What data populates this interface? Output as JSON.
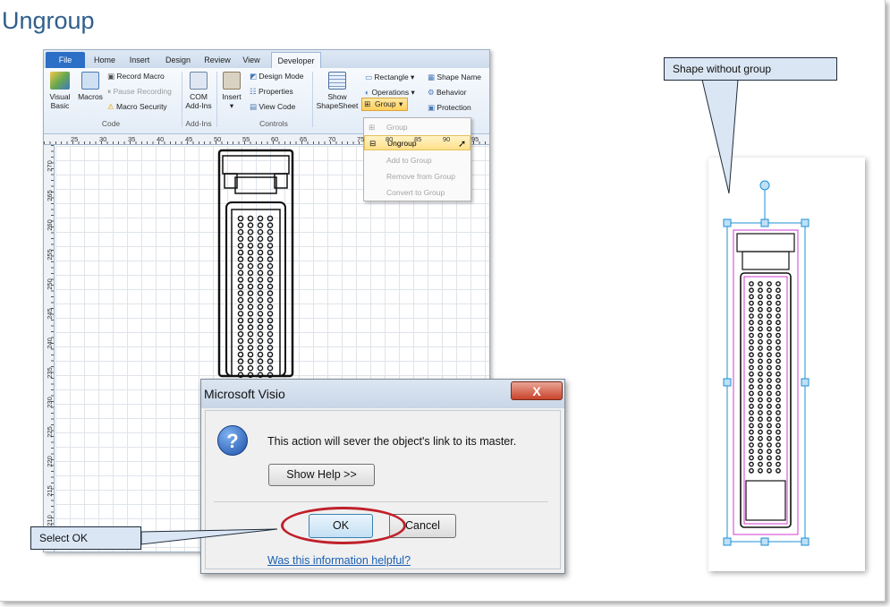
{
  "page": {
    "title": "Ungroup"
  },
  "visio": {
    "tabs": [
      "File",
      "Home",
      "Insert",
      "Design",
      "Review",
      "View",
      "Developer"
    ],
    "active_tab": "Developer",
    "ribbon": {
      "code": {
        "visual_basic": "Visual Basic",
        "macros": "Macros",
        "record_macro": "Record Macro",
        "pause_recording": "Pause Recording",
        "macro_security": "Macro Security",
        "label": "Code"
      },
      "addins": {
        "com_addins": "COM Add-Ins",
        "label": "Add-Ins"
      },
      "controls": {
        "insert": "Insert",
        "design_mode": "Design Mode",
        "properties": "Properties",
        "view_code": "View Code",
        "label": "Controls"
      },
      "show_shapesheet": "Show ShapeSheet",
      "shape_design": {
        "rectangle": "Rectangle",
        "operations": "Operations",
        "group": "Group",
        "shape_name": "Shape Name",
        "behavior": "Behavior",
        "protection": "Protection"
      }
    },
    "group_menu": {
      "items": [
        {
          "label": "Group",
          "enabled": false
        },
        {
          "label": "Ungroup",
          "enabled": true,
          "highlighted": true
        },
        {
          "label": "Add to Group",
          "enabled": false
        },
        {
          "label": "Remove from Group",
          "enabled": false
        },
        {
          "label": "Convert to Group",
          "enabled": false
        }
      ]
    },
    "ruler_h": [
      "25",
      "30",
      "35",
      "40",
      "45",
      "50",
      "55",
      "60",
      "65",
      "70",
      "75",
      "80",
      "85",
      "90",
      "95"
    ],
    "ruler_v": [
      "270",
      "265",
      "260",
      "255",
      "250",
      "245",
      "240",
      "235",
      "230",
      "225",
      "220",
      "215",
      "210"
    ]
  },
  "dialog": {
    "title": "Microsoft Visio",
    "close": "X",
    "message": "This action will sever the object's link to its master.",
    "show_help": "Show Help >>",
    "ok": "OK",
    "cancel": "Cancel",
    "helpful_link": "Was this information helpful?"
  },
  "callouts": {
    "select_ok": "Select OK",
    "shape_without_group": "Shape without group"
  },
  "colors": {
    "accent": "#2f5e8c",
    "highlight_ring": "#c0202a",
    "selection": "#1e8fd6",
    "magenta": "#d23cd2"
  }
}
